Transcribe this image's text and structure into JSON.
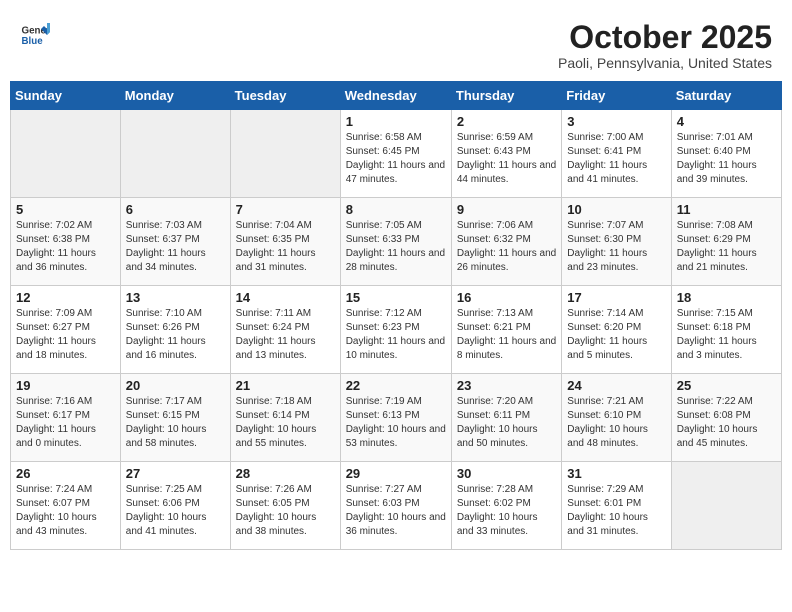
{
  "header": {
    "logo": {
      "general": "General",
      "blue": "Blue"
    },
    "title": "October 2025",
    "location": "Paoli, Pennsylvania, United States"
  },
  "weekdays": [
    "Sunday",
    "Monday",
    "Tuesday",
    "Wednesday",
    "Thursday",
    "Friday",
    "Saturday"
  ],
  "weeks": [
    [
      {
        "day": "",
        "empty": true
      },
      {
        "day": "",
        "empty": true
      },
      {
        "day": "",
        "empty": true
      },
      {
        "day": "1",
        "sunrise": "6:58 AM",
        "sunset": "6:45 PM",
        "daylight": "11 hours and 47 minutes."
      },
      {
        "day": "2",
        "sunrise": "6:59 AM",
        "sunset": "6:43 PM",
        "daylight": "11 hours and 44 minutes."
      },
      {
        "day": "3",
        "sunrise": "7:00 AM",
        "sunset": "6:41 PM",
        "daylight": "11 hours and 41 minutes."
      },
      {
        "day": "4",
        "sunrise": "7:01 AM",
        "sunset": "6:40 PM",
        "daylight": "11 hours and 39 minutes."
      }
    ],
    [
      {
        "day": "5",
        "sunrise": "7:02 AM",
        "sunset": "6:38 PM",
        "daylight": "11 hours and 36 minutes."
      },
      {
        "day": "6",
        "sunrise": "7:03 AM",
        "sunset": "6:37 PM",
        "daylight": "11 hours and 34 minutes."
      },
      {
        "day": "7",
        "sunrise": "7:04 AM",
        "sunset": "6:35 PM",
        "daylight": "11 hours and 31 minutes."
      },
      {
        "day": "8",
        "sunrise": "7:05 AM",
        "sunset": "6:33 PM",
        "daylight": "11 hours and 28 minutes."
      },
      {
        "day": "9",
        "sunrise": "7:06 AM",
        "sunset": "6:32 PM",
        "daylight": "11 hours and 26 minutes."
      },
      {
        "day": "10",
        "sunrise": "7:07 AM",
        "sunset": "6:30 PM",
        "daylight": "11 hours and 23 minutes."
      },
      {
        "day": "11",
        "sunrise": "7:08 AM",
        "sunset": "6:29 PM",
        "daylight": "11 hours and 21 minutes."
      }
    ],
    [
      {
        "day": "12",
        "sunrise": "7:09 AM",
        "sunset": "6:27 PM",
        "daylight": "11 hours and 18 minutes."
      },
      {
        "day": "13",
        "sunrise": "7:10 AM",
        "sunset": "6:26 PM",
        "daylight": "11 hours and 16 minutes."
      },
      {
        "day": "14",
        "sunrise": "7:11 AM",
        "sunset": "6:24 PM",
        "daylight": "11 hours and 13 minutes."
      },
      {
        "day": "15",
        "sunrise": "7:12 AM",
        "sunset": "6:23 PM",
        "daylight": "11 hours and 10 minutes."
      },
      {
        "day": "16",
        "sunrise": "7:13 AM",
        "sunset": "6:21 PM",
        "daylight": "11 hours and 8 minutes."
      },
      {
        "day": "17",
        "sunrise": "7:14 AM",
        "sunset": "6:20 PM",
        "daylight": "11 hours and 5 minutes."
      },
      {
        "day": "18",
        "sunrise": "7:15 AM",
        "sunset": "6:18 PM",
        "daylight": "11 hours and 3 minutes."
      }
    ],
    [
      {
        "day": "19",
        "sunrise": "7:16 AM",
        "sunset": "6:17 PM",
        "daylight": "11 hours and 0 minutes."
      },
      {
        "day": "20",
        "sunrise": "7:17 AM",
        "sunset": "6:15 PM",
        "daylight": "10 hours and 58 minutes."
      },
      {
        "day": "21",
        "sunrise": "7:18 AM",
        "sunset": "6:14 PM",
        "daylight": "10 hours and 55 minutes."
      },
      {
        "day": "22",
        "sunrise": "7:19 AM",
        "sunset": "6:13 PM",
        "daylight": "10 hours and 53 minutes."
      },
      {
        "day": "23",
        "sunrise": "7:20 AM",
        "sunset": "6:11 PM",
        "daylight": "10 hours and 50 minutes."
      },
      {
        "day": "24",
        "sunrise": "7:21 AM",
        "sunset": "6:10 PM",
        "daylight": "10 hours and 48 minutes."
      },
      {
        "day": "25",
        "sunrise": "7:22 AM",
        "sunset": "6:08 PM",
        "daylight": "10 hours and 45 minutes."
      }
    ],
    [
      {
        "day": "26",
        "sunrise": "7:24 AM",
        "sunset": "6:07 PM",
        "daylight": "10 hours and 43 minutes."
      },
      {
        "day": "27",
        "sunrise": "7:25 AM",
        "sunset": "6:06 PM",
        "daylight": "10 hours and 41 minutes."
      },
      {
        "day": "28",
        "sunrise": "7:26 AM",
        "sunset": "6:05 PM",
        "daylight": "10 hours and 38 minutes."
      },
      {
        "day": "29",
        "sunrise": "7:27 AM",
        "sunset": "6:03 PM",
        "daylight": "10 hours and 36 minutes."
      },
      {
        "day": "30",
        "sunrise": "7:28 AM",
        "sunset": "6:02 PM",
        "daylight": "10 hours and 33 minutes."
      },
      {
        "day": "31",
        "sunrise": "7:29 AM",
        "sunset": "6:01 PM",
        "daylight": "10 hours and 31 minutes."
      },
      {
        "day": "",
        "empty": true
      }
    ]
  ]
}
